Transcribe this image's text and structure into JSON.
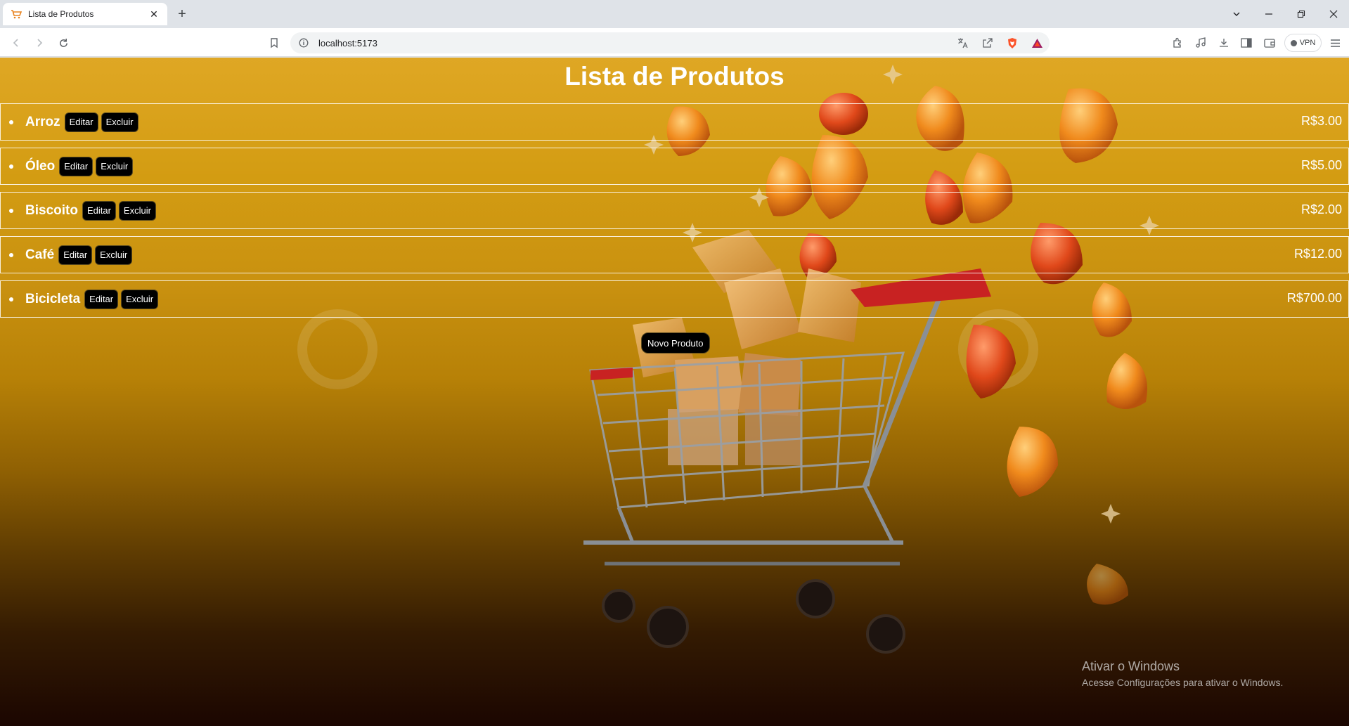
{
  "browser": {
    "tab_title": "Lista de Produtos",
    "url": "localhost:5173",
    "vpn_label": "VPN",
    "icons": [
      "cart-favicon-icon",
      "close-icon",
      "plus-icon",
      "chevron-down-icon",
      "minimize-icon",
      "restore-icon",
      "window-close-icon",
      "back-icon",
      "forward-icon",
      "reload-icon",
      "bookmark-icon",
      "site-info-icon",
      "translate-icon",
      "share-icon",
      "brave-shield-icon",
      "brave-rewards-icon",
      "extensions-icon",
      "media-icon",
      "download-icon",
      "sidebar-icon",
      "wallet-icon",
      "menu-icon"
    ]
  },
  "page": {
    "title": "Lista de Produtos",
    "new_product_label": "Novo Produto",
    "edit_label": "Editar",
    "delete_label": "Excluir",
    "products": [
      {
        "name": "Arroz",
        "price": "R$3.00"
      },
      {
        "name": "Óleo",
        "price": "R$5.00"
      },
      {
        "name": "Biscoito",
        "price": "R$2.00"
      },
      {
        "name": "Café",
        "price": "R$12.00"
      },
      {
        "name": "Bicicleta",
        "price": "R$700.00"
      }
    ]
  },
  "watermark": {
    "title": "Ativar o Windows",
    "subtitle": "Acesse Configurações para ativar o Windows."
  },
  "colors": {
    "background_top": "#dfa724",
    "background_bottom": "#1b0601",
    "button_bg": "#000000",
    "text": "#ffffff"
  }
}
